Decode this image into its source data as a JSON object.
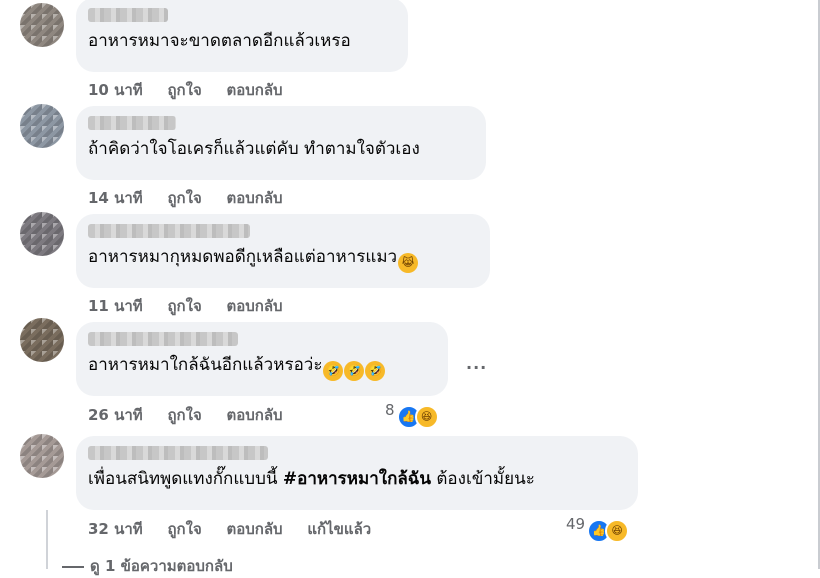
{
  "comments": [
    {
      "text": "อาหารหมาจะขาดตลาดอีกแล้วเหรอ",
      "time": "10 นาที",
      "like": "ถูกใจ",
      "reply": "ตอบกลับ"
    },
    {
      "text": "ถ้าคิดว่าใจโอเครก็แล้วแต่คับ ทำตามใจตัวเอง",
      "time": "14 นาที",
      "like": "ถูกใจ",
      "reply": "ตอบกลับ"
    },
    {
      "text": "อาหารหมากุหมดพอดีกูเหลือแต่อาหารแมว",
      "emoji": "crying-laughing-cat",
      "time": "11 นาที",
      "like": "ถูกใจ",
      "reply": "ตอบกลับ"
    },
    {
      "text": "อาหารหมาใกล้ฉันอีกแล้วหรอว่ะ",
      "emoji": "rolling-on-floor-laughing x3",
      "time": "26 นาที",
      "like": "ถูกใจ",
      "reply": "ตอบกลับ",
      "reactions_count": "8",
      "more": "..."
    },
    {
      "text_prefix": "เพื่อนสนิทพูดแทงกั๊กแบบนี้",
      "hashtag": "#อาหารหมาใกล้ฉัน",
      "text_suffix": "ต้องเข้ามั้ยนะ",
      "time": "32 นาที",
      "like": "ถูกใจ",
      "reply": "ตอบกลับ",
      "edited": "แก้ไขแล้ว",
      "reactions_count": "49"
    }
  ],
  "replies_link": "ดู 1 ข้อความตอบกลับ",
  "colors": {
    "bubble": "#f0f2f5",
    "meta": "#65676b",
    "like_blue": "#1877f2",
    "emoji_yellow": "#f7b928"
  }
}
